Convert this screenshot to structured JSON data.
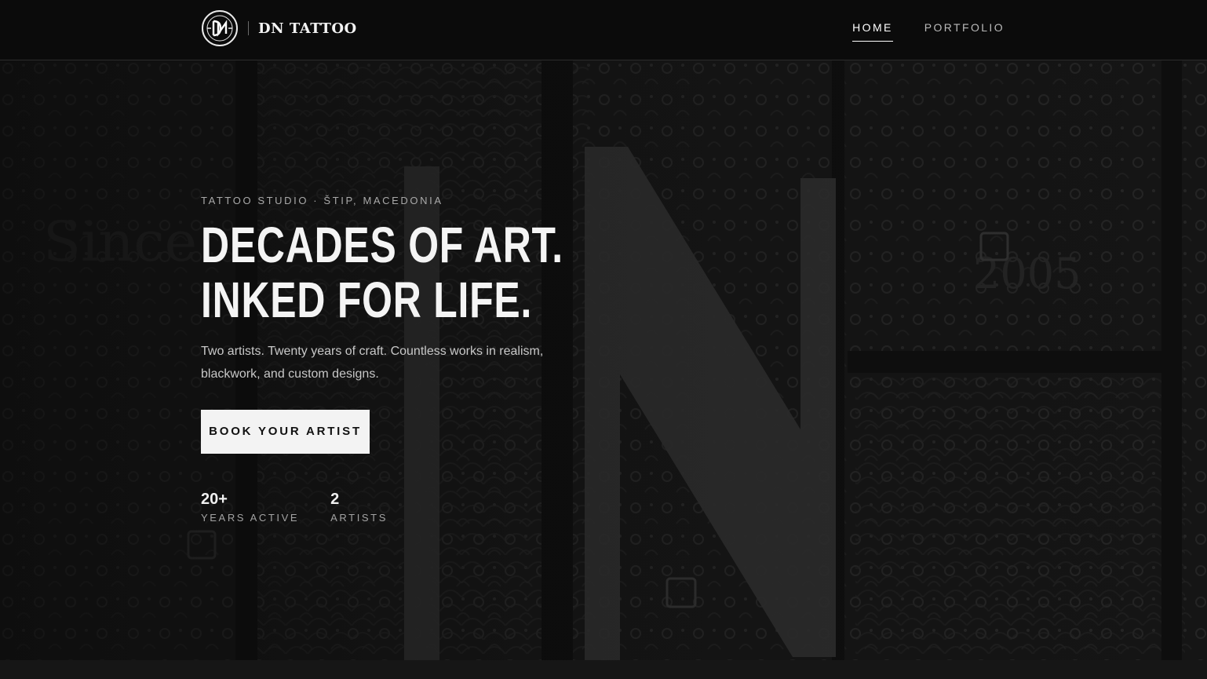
{
  "header": {
    "brand": "DN TATTOO",
    "logo_badge_text": "TATTOO STUDIO",
    "nav": [
      {
        "label": "HOME",
        "active": true
      },
      {
        "label": "PORTFOLIO",
        "active": false
      }
    ]
  },
  "hero": {
    "eyebrow": "TATTOO STUDIO · ŠTIP, MACEDONIA",
    "headline_line1": "DECADES OF ART.",
    "headline_line2": "INKED FOR LIFE.",
    "subtext": "Two artists. Twenty years of craft. Countless works in realism, blackwork, and custom designs.",
    "cta_label": "BOOK YOUR ARTIST",
    "stats": [
      {
        "value": "20+",
        "label": "YEARS ACTIVE"
      },
      {
        "value": "2",
        "label": "ARTISTS"
      }
    ],
    "background_text": [
      "Since",
      "2005",
      "DN"
    ]
  },
  "colors": {
    "header_bg": "#0b0b0b",
    "cta_bg": "#f3f3f3",
    "cta_text": "#111111",
    "text_primary": "#f4f4f4",
    "text_muted": "#a9a9a9"
  }
}
